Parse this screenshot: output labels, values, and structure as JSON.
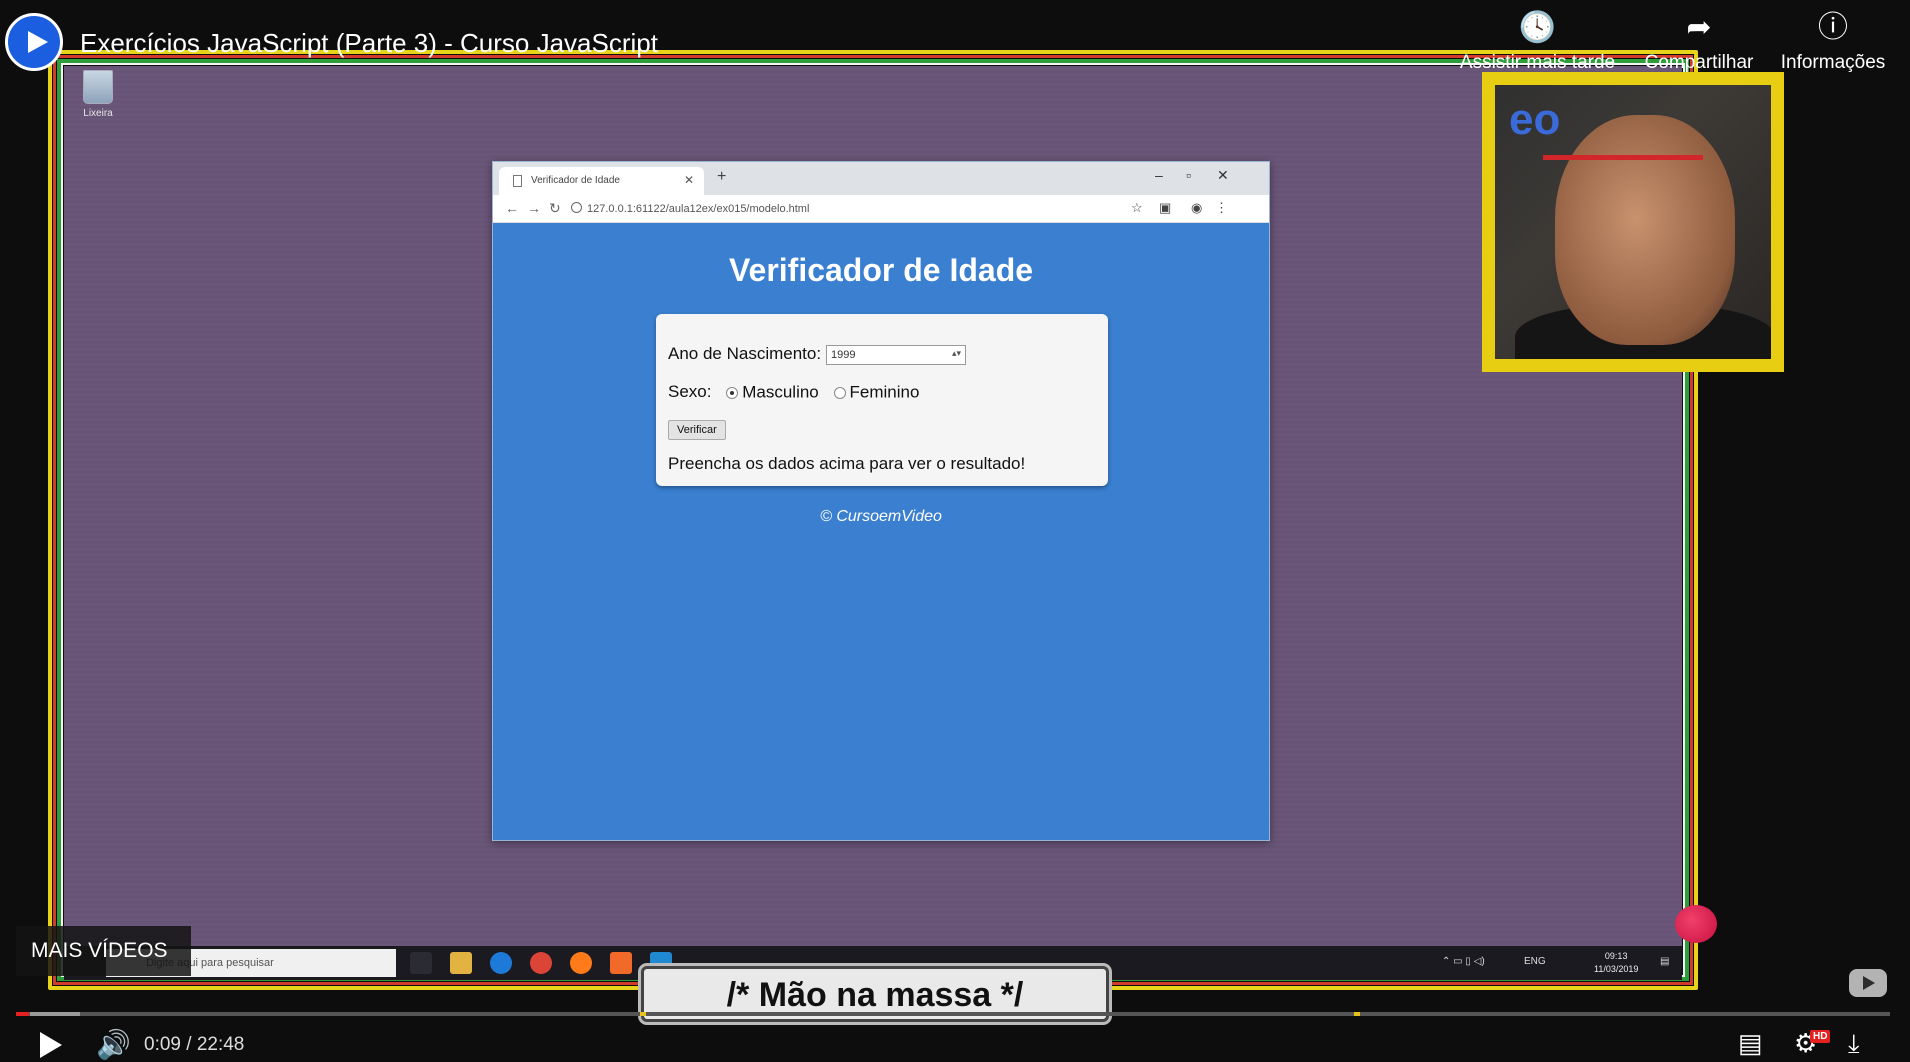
{
  "video": {
    "title": "Exercícios JavaScript (Parte 3) - Curso JavaScript",
    "actions": [
      "Assistir mais tarde",
      "Compartilhar",
      "Informações"
    ],
    "more_videos": "MAIS VÍDEOS",
    "caption_banner": "/* Mão na massa */",
    "time_current": "0:09",
    "time_separator": "/",
    "time_total": "22:48",
    "progress": 0.007
  },
  "desktop": {
    "recycle_label": "Lixeira"
  },
  "browser": {
    "tab_title": "Verificador de Idade",
    "url": "127.0.0.1:61122/aula12ex/ex015/modelo.html"
  },
  "page": {
    "heading": "Verificador de Idade",
    "ano_label": "Ano de Nascimento:",
    "ano_value": "1999",
    "sexo_label": "Sexo:",
    "sexo_options": [
      "Masculino",
      "Feminino"
    ],
    "sexo_selected": "Masculino",
    "button_label": "Verificar",
    "result_text": "Preencha os dados acima para ver o resultado!",
    "footer": "© CursoemVideo"
  },
  "taskbar": {
    "search_placeholder": "Digite aqui para pesquisar",
    "lang": "ENG",
    "clock_time": "09:13",
    "clock_date": "11/03/2019"
  },
  "colors": {
    "page_bg": "#3a7fd0",
    "desktop_bg": "#6a5678",
    "frame_yellow": "#e8d31b",
    "progress_red": "#e52020"
  }
}
